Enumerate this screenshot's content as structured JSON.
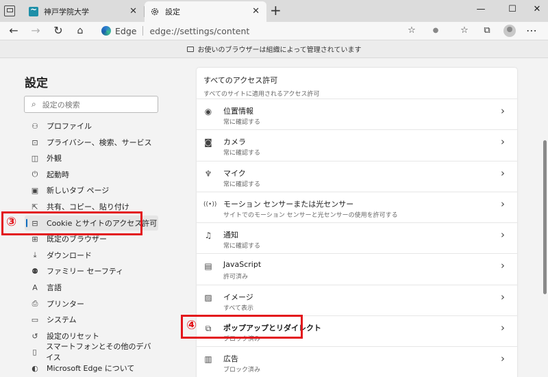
{
  "tabs": [
    {
      "title": "神戸学院大学",
      "icon": "university-favicon-icon"
    },
    {
      "title": "設定",
      "icon": "gear-icon"
    }
  ],
  "window": {
    "minimize": "—",
    "maximize": "☐",
    "close": "✕"
  },
  "address": {
    "site": "Edge",
    "url": "edge://settings/content"
  },
  "managed_notice": "お使いのブラウザーは組織によって管理されています",
  "sidebar": {
    "title": "設定",
    "search_placeholder": "設定の検索",
    "items": [
      {
        "label": "プロファイル",
        "icon": "profile-icon"
      },
      {
        "label": "プライバシー、検索、サービス",
        "icon": "lock-icon"
      },
      {
        "label": "外観",
        "icon": "appearance-icon"
      },
      {
        "label": "起動時",
        "icon": "power-icon"
      },
      {
        "label": "新しいタブ ページ",
        "icon": "new-tab-icon"
      },
      {
        "label": "共有、コピー、貼り付け",
        "icon": "share-icon"
      },
      {
        "label": "Cookie とサイトのアクセス許可",
        "icon": "cookie-permissions-icon"
      },
      {
        "label": "既定のブラウザー",
        "icon": "default-browser-icon"
      },
      {
        "label": "ダウンロード",
        "icon": "download-icon"
      },
      {
        "label": "ファミリー セーフティ",
        "icon": "family-icon"
      },
      {
        "label": "言語",
        "icon": "language-icon"
      },
      {
        "label": "プリンター",
        "icon": "printer-icon"
      },
      {
        "label": "システム",
        "icon": "system-icon"
      },
      {
        "label": "設定のリセット",
        "icon": "reset-icon"
      },
      {
        "label": "スマートフォンとその他のデバイス",
        "icon": "phone-icon"
      },
      {
        "label": "Microsoft Edge について",
        "icon": "edge-logo-icon"
      }
    ]
  },
  "main": {
    "section_title": "すべてのアクセス許可",
    "section_subtitle": "すべてのサイトに適用されるアクセス許可",
    "permissions": [
      {
        "label": "位置情報",
        "status": "常に確認する",
        "icon": "location-icon"
      },
      {
        "label": "カメラ",
        "status": "常に確認する",
        "icon": "camera-icon"
      },
      {
        "label": "マイク",
        "status": "常に確認する",
        "icon": "microphone-icon"
      },
      {
        "label": "モーション センサーまたは光センサー",
        "status": "サイトでのモーション センサーと光センサーの使用を許可する",
        "icon": "sensor-icon"
      },
      {
        "label": "通知",
        "status": "常に確認する",
        "icon": "bell-icon"
      },
      {
        "label": "JavaScript",
        "status": "許可済み",
        "icon": "javascript-icon"
      },
      {
        "label": "イメージ",
        "status": "すべて表示",
        "icon": "image-icon"
      },
      {
        "label": "ポップアップとリダイレクト",
        "status": "ブロック済み",
        "icon": "popup-icon"
      },
      {
        "label": "広告",
        "status": "ブロック済み",
        "icon": "ads-icon"
      }
    ]
  },
  "annotations": {
    "step3": "③",
    "step4": "④",
    "color": "#e3141b"
  },
  "colors": {
    "accent": "#0f6cbd",
    "annotation": "#e3141b"
  }
}
